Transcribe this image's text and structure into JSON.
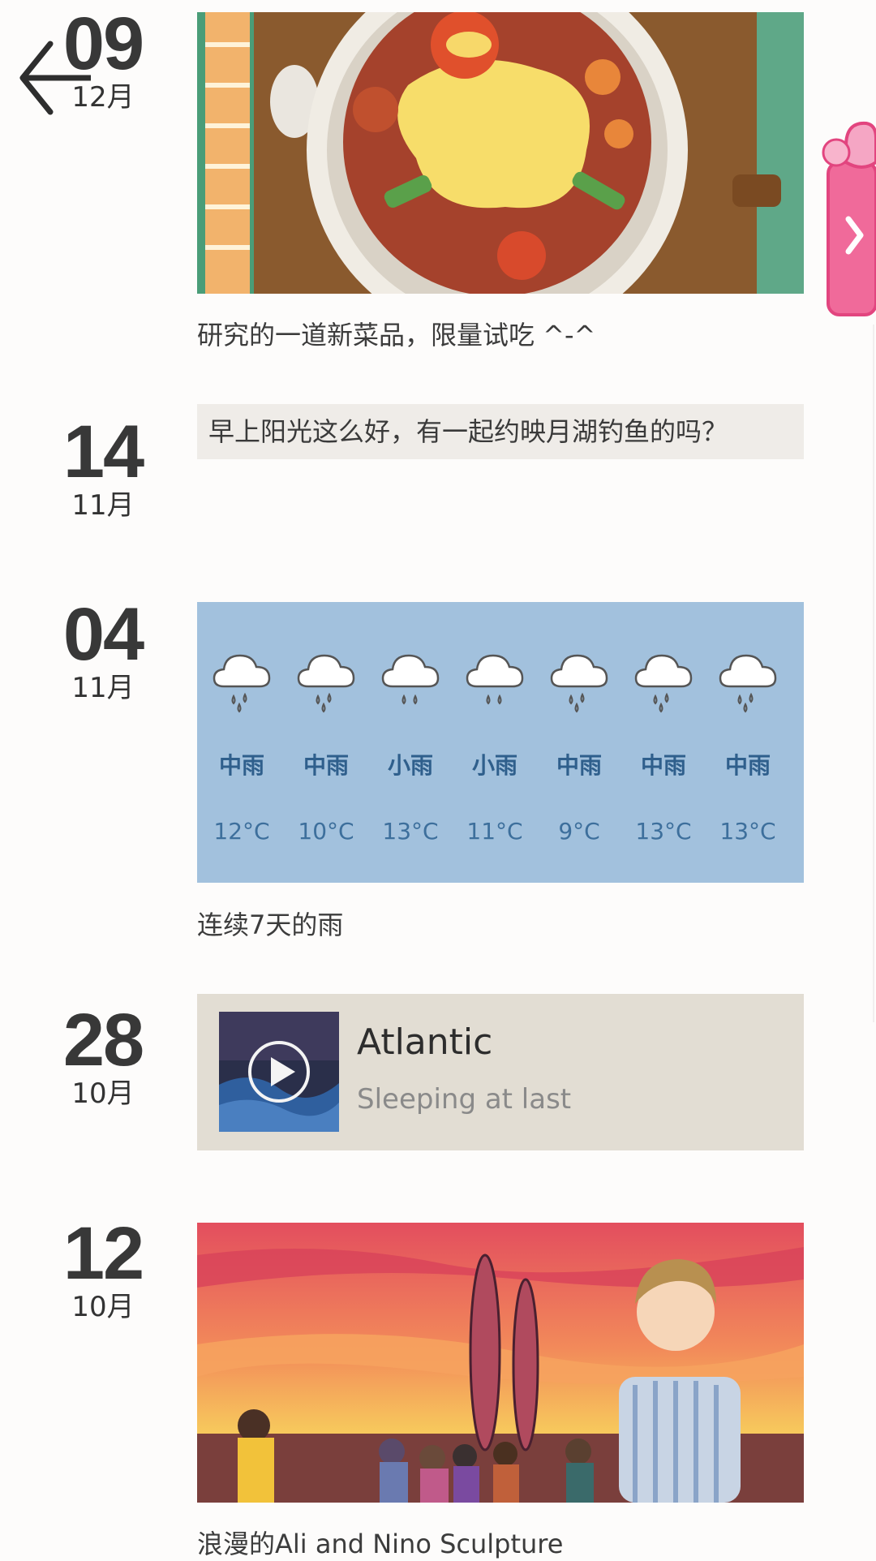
{
  "navigation": {
    "back_icon": "arrow-left-icon",
    "side_tab_icon": "heart-chevron-right-icon"
  },
  "posts": [
    {
      "day": "09",
      "month": "12月",
      "type": "image",
      "image": "claypot-dish-illustration",
      "caption": "研究的一道新菜品，限量试吃 ^-^"
    },
    {
      "day": "14",
      "month": "11月",
      "type": "text",
      "text": "早上阳光这么好，有一起约映月湖钓鱼的吗？"
    },
    {
      "day": "04",
      "month": "11月",
      "type": "weather",
      "caption": "连续7天的雨",
      "forecast": [
        {
          "condition": "中雨",
          "temp": "12°C",
          "icon": "rain-cloud-icon"
        },
        {
          "condition": "中雨",
          "temp": "10°C",
          "icon": "rain-cloud-icon"
        },
        {
          "condition": "小雨",
          "temp": "13°C",
          "icon": "rain-cloud-icon"
        },
        {
          "condition": "小雨",
          "temp": "11°C",
          "icon": "rain-cloud-icon"
        },
        {
          "condition": "中雨",
          "temp": "9°C",
          "icon": "rain-cloud-icon"
        },
        {
          "condition": "中雨",
          "temp": "13°C",
          "icon": "rain-cloud-icon"
        },
        {
          "condition": "中雨",
          "temp": "13°C",
          "icon": "rain-cloud-icon"
        }
      ]
    },
    {
      "day": "28",
      "month": "10月",
      "type": "music",
      "song": "Atlantic",
      "artist": "Sleeping at last",
      "play_icon": "play-icon"
    },
    {
      "day": "12",
      "month": "10月",
      "type": "image",
      "image": "sunset-sculpture-illustration",
      "caption": "浪漫的Ali and Nino Sculpture"
    }
  ],
  "colors": {
    "weather_bg": "#a2c1dd",
    "text_bubble_bg": "#efece8",
    "music_bg": "#e2ddd3",
    "side_tab": "#f06a9a"
  }
}
